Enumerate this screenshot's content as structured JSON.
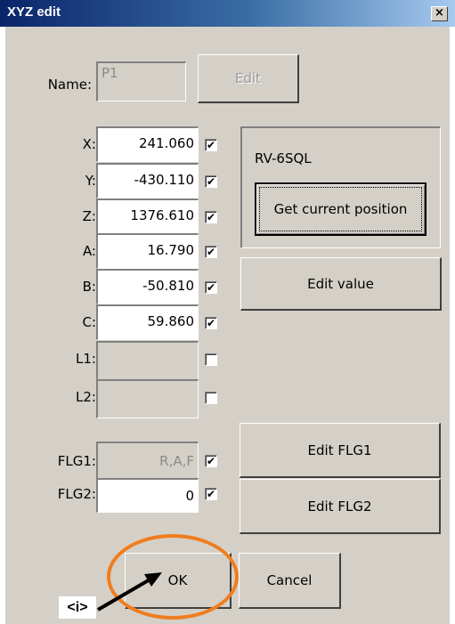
{
  "window": {
    "title": "XYZ edit",
    "close_glyph": "×"
  },
  "name_row": {
    "label": "Name:",
    "value": "P1",
    "edit_button": "Edit"
  },
  "coords": [
    {
      "label": "X:",
      "value": "241.060",
      "checked": true,
      "enabled": true
    },
    {
      "label": "Y:",
      "value": "-430.110",
      "checked": true,
      "enabled": true
    },
    {
      "label": "Z:",
      "value": "1376.610",
      "checked": true,
      "enabled": true
    },
    {
      "label": "A:",
      "value": "16.790",
      "checked": true,
      "enabled": true
    },
    {
      "label": "B:",
      "value": "-50.810",
      "checked": true,
      "enabled": true
    },
    {
      "label": "C:",
      "value": "59.860",
      "checked": true,
      "enabled": true
    },
    {
      "label": "L1:",
      "value": "",
      "checked": false,
      "enabled": false
    },
    {
      "label": "L2:",
      "value": "",
      "checked": false,
      "enabled": false
    }
  ],
  "flags": [
    {
      "label": "FLG1:",
      "value": "R,A,F",
      "checked": true,
      "enabled": false,
      "button": "Edit FLG1"
    },
    {
      "label": "FLG2:",
      "value": "0",
      "checked": true,
      "enabled": true,
      "button": "Edit FLG2"
    }
  ],
  "robot_group": {
    "model": "RV-6SQL",
    "get_position_button": "Get current position"
  },
  "edit_value_button": "Edit value",
  "footer": {
    "ok_button": "OK",
    "cancel_button": "Cancel"
  },
  "annotation": {
    "label": "<i>",
    "color": "#f07d1e"
  },
  "check_glyph": "✔"
}
